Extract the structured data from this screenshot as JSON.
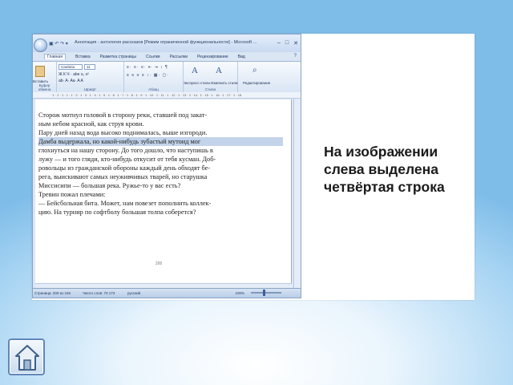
{
  "word": {
    "title": "Аннотация - антология рассказов [Режим ограниченной функциональности] - Microsoft ...",
    "tabs": [
      "Главная",
      "Вставка",
      "Разметка страницы",
      "Ссылки",
      "Рассылки",
      "Рецензирование",
      "Вид"
    ],
    "ribbon": {
      "paste_label": "Вставить",
      "font_name": "Cambria",
      "font_size": "11",
      "format_row": "Ж К Ч · abe x₂ x²",
      "format_row2": "ab· A· Aa· A A",
      "para_row1": "≡· ≡· ≡· ⇤ ⇥ ↕ ¶",
      "para_row2": "≡ ≡ ≡ ≡ ↕· ▦· ▢·",
      "style_express": "Экспресс-стили",
      "style_change": "Изменить стили",
      "editing": "Редактирование",
      "group_clipboard": "Буфер обмена",
      "group_font": "Шрифт",
      "group_paragraph": "Абзац",
      "group_styles": "Стили"
    },
    "ruler_text": "· 1 · 2 · 1 · 1 · 1 · 2 · 1 · 3 · 1 · 4 · 1 · 5 · 1 · 6 · 1 · 7 · 1 · 8 · 1 · 9 · 1 · 10 · 1 · 11 · 1 · 12 · 1 · 13 · 1 · 14 · 1 · 15 · 1 · 16 · 1 · 17 · 1 · 18",
    "document_lines": [
      "  Сторож мотнул головой в сторону реки, ставшей под закат-",
      "ным небом красной, как струя крови.",
      "  Пару дней назад вода высоко поднималась, выше изгороди.",
      "Дамба выдержала, но какой-нибудь зубастый мутоид мог",
      "глохнуться на нашу сторону. До того дошло, что наступишь в",
      "лужу — и того гляди, кто-нибудь откусит от тебя кусман. Доб-",
      "ровольцы из гражданской обороны каждый день обходят бе-",
      "рега, выискивают самых неуживчивых тварей, но старушка",
      "Миссисипи — большая река. Ружье-то у вас есть?",
      "  Тревин пожал плечами:",
      "  — Бейсбольная бита. Может, нам повезет пополнить коллек-",
      "цию. На турнир по софтболу большая толпа соберется?"
    ],
    "highlighted_line_index": 3,
    "page_number": "200",
    "status": {
      "page": "Страница: 200 из 246",
      "words": "Число слов: 70 173",
      "lang": "русский",
      "zoom": "100%"
    }
  },
  "caption_lines": [
    "На изображении",
    "слева выделена",
    "четвёртая строка"
  ]
}
